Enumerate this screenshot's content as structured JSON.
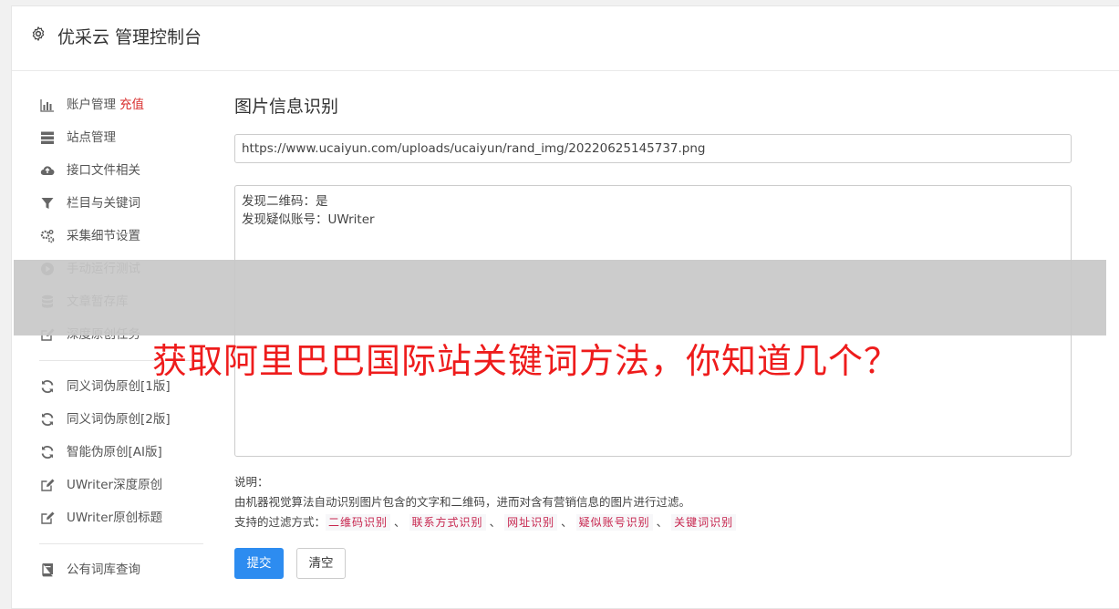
{
  "header": {
    "title": "优采云 管理控制台",
    "icon": "gear-icon"
  },
  "sidebar": {
    "group1": [
      {
        "label": "账户管理",
        "extra": "充值",
        "icon": "bar-chart-icon"
      },
      {
        "label": "站点管理",
        "icon": "server-icon"
      },
      {
        "label": "接口文件相关",
        "icon": "cloud-upload-icon"
      },
      {
        "label": "栏目与关键词",
        "icon": "filter-icon"
      },
      {
        "label": "采集细节设置",
        "icon": "gears-icon"
      },
      {
        "label": "手动运行测试",
        "icon": "play-circle-icon"
      },
      {
        "label": "文章暂存库",
        "icon": "database-icon"
      },
      {
        "label": "深度原创任务",
        "icon": "edit-icon"
      }
    ],
    "group2": [
      {
        "label": "同义词伪原创[1版]",
        "icon": "refresh-icon"
      },
      {
        "label": "同义词伪原创[2版]",
        "icon": "refresh-icon"
      },
      {
        "label": "智能伪原创[AI版]",
        "icon": "refresh-icon"
      },
      {
        "label": "UWriter深度原创",
        "icon": "edit-icon"
      },
      {
        "label": "UWriter原创标题",
        "icon": "edit-icon"
      }
    ],
    "group3": [
      {
        "label": "公有词库查询",
        "icon": "book-icon"
      }
    ]
  },
  "main": {
    "title": "图片信息识别",
    "url_value": "https://www.ucaiyun.com/uploads/ucaiyun/rand_img/20220625145737.png",
    "result_lines": [
      "发现二维码：是",
      "发现疑似账号：UWriter"
    ],
    "desc_heading": "说明：",
    "desc_text": "由机器视觉算法自动识别图片包含的文字和二维码，进而对含有营销信息的图片进行过滤。",
    "filter_label": "支持的过滤方式：",
    "filter_tags": [
      "二维码识别",
      "联系方式识别",
      "网址识别",
      "疑似账号识别",
      "关键词识别"
    ],
    "filter_sep": "、",
    "submit_label": "提交",
    "clear_label": "清空"
  },
  "overlay": {
    "headline": "获取阿里巴巴国际站关键词方法，你知道几个？"
  },
  "colors": {
    "accent": "#2d8cf0",
    "recharge": "#d9302f",
    "headline": "#ee1c1c",
    "tag": "#c7254e"
  }
}
